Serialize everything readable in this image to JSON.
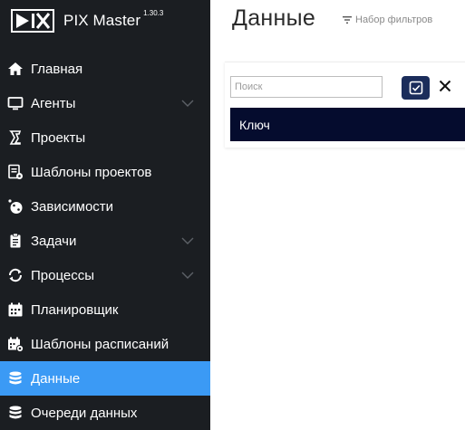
{
  "brand": {
    "name": "PIX Master",
    "version": "1.30.3",
    "logo_icon": "pix-logo-icon"
  },
  "sidebar": {
    "items": [
      {
        "label": "Главная",
        "icon": "home-icon",
        "has_submenu": false,
        "active": false
      },
      {
        "label": "Агенты",
        "icon": "monitor-icon",
        "has_submenu": true,
        "active": false
      },
      {
        "label": "Проекты",
        "icon": "projects-icon",
        "has_submenu": false,
        "active": false
      },
      {
        "label": "Шаблоны проектов",
        "icon": "project-template-icon",
        "has_submenu": false,
        "active": false
      },
      {
        "label": "Зависимости",
        "icon": "dependencies-icon",
        "has_submenu": false,
        "active": false
      },
      {
        "label": "Задачи",
        "icon": "clipboard-icon",
        "has_submenu": true,
        "active": false
      },
      {
        "label": "Процессы",
        "icon": "refresh-icon",
        "has_submenu": true,
        "active": false
      },
      {
        "label": "Планировщик",
        "icon": "calendar-icon",
        "has_submenu": false,
        "active": false
      },
      {
        "label": "Шаблоны расписаний",
        "icon": "calendar-settings-icon",
        "has_submenu": false,
        "active": false
      },
      {
        "label": "Данные",
        "icon": "database-icon",
        "has_submenu": false,
        "active": true
      },
      {
        "label": "Очереди данных",
        "icon": "database-queue-icon",
        "has_submenu": false,
        "active": false
      }
    ]
  },
  "header": {
    "title": "Данные",
    "filter_set_label": "Набор фильтров"
  },
  "search": {
    "placeholder": "Поиск",
    "value": ""
  },
  "table": {
    "columns": [
      "Ключ"
    ]
  },
  "colors": {
    "sidebar_bg": "#1b1e22",
    "active_item": "#3b9af5",
    "apply_button": "#1b2d5b",
    "table_header": "#050c2e"
  }
}
